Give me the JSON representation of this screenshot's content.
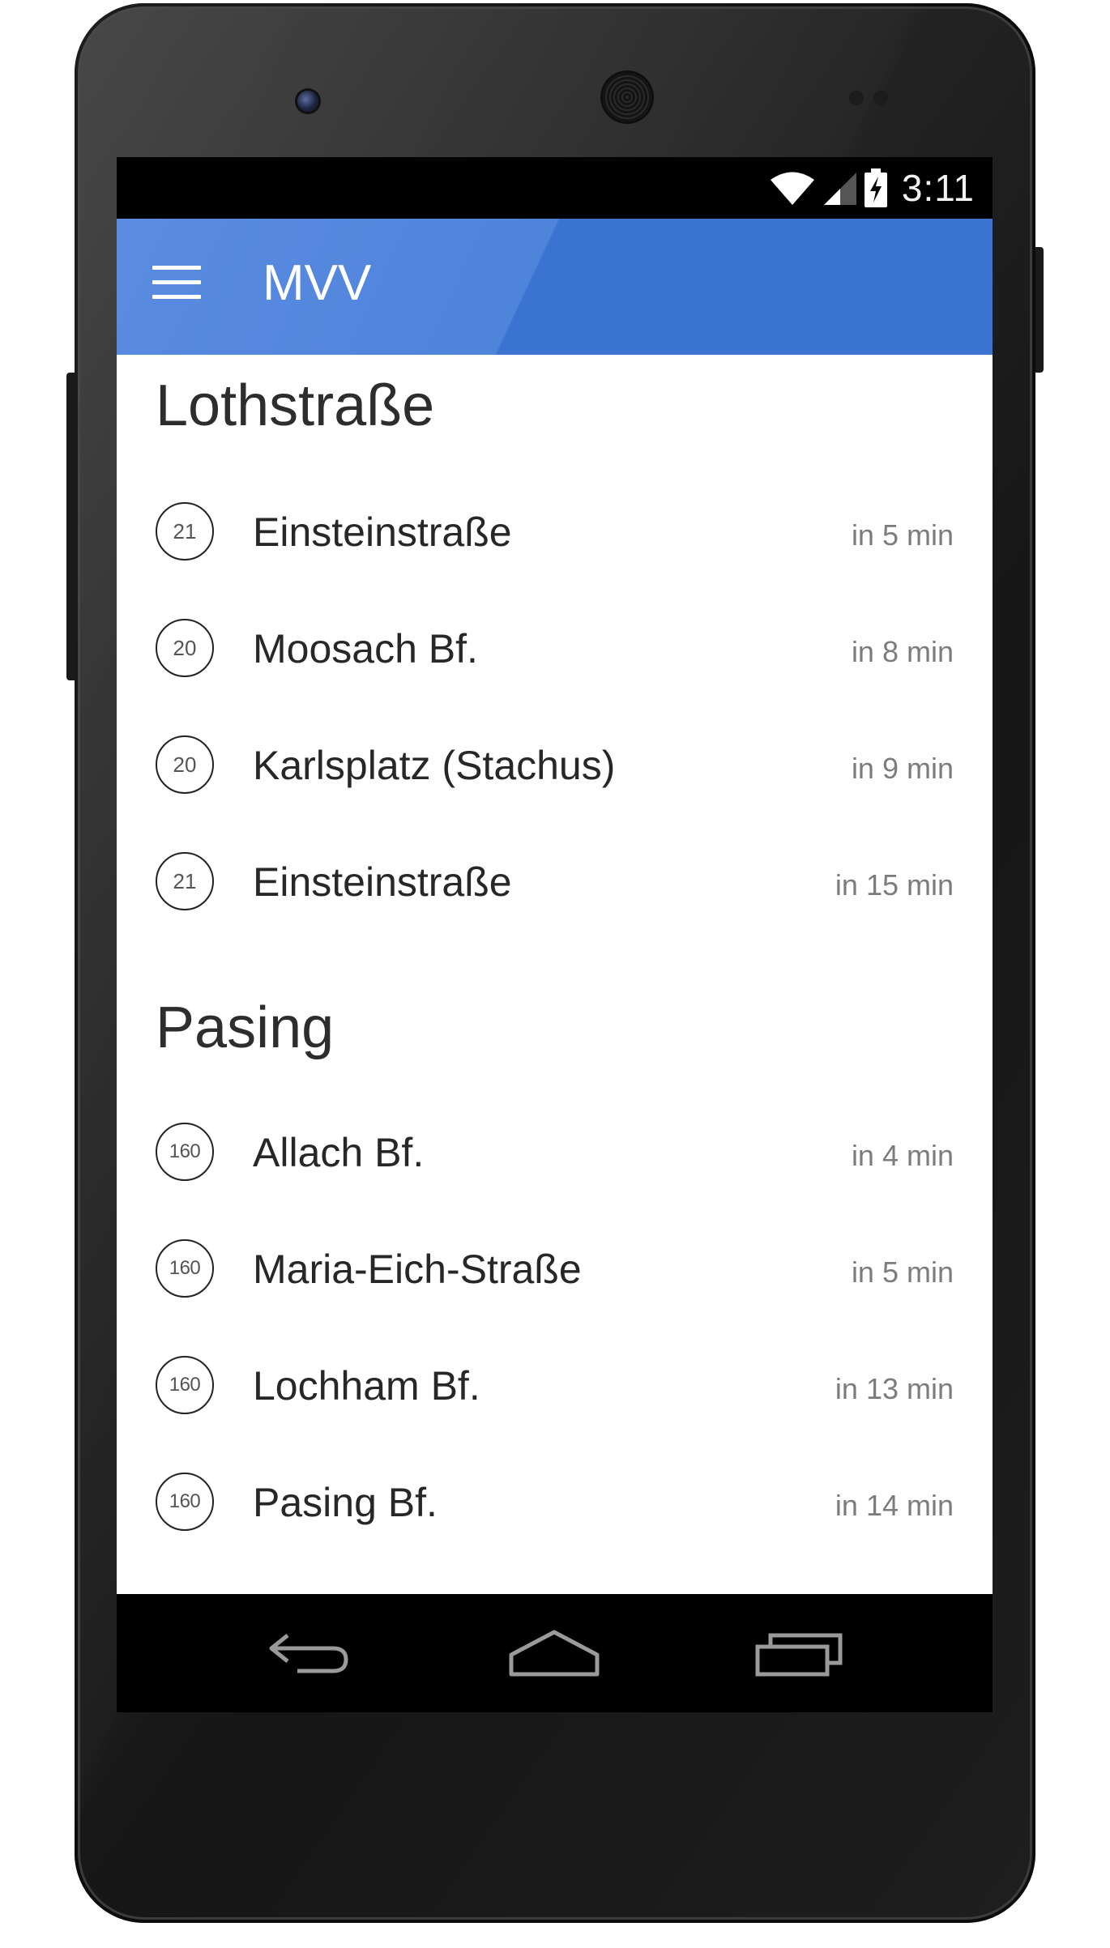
{
  "status_bar": {
    "time": "3:11",
    "icons": [
      "wifi-icon",
      "signal-icon",
      "battery-charging-icon"
    ]
  },
  "app_bar": {
    "title": "MVV",
    "menu_icon": "menu-icon"
  },
  "sections": [
    {
      "title": "Lothstraße",
      "departures": [
        {
          "line": "21",
          "destination": "Einsteinstraße",
          "eta": "in 5 min"
        },
        {
          "line": "20",
          "destination": "Moosach Bf.",
          "eta": "in 8 min"
        },
        {
          "line": "20",
          "destination": "Karlsplatz (Stachus)",
          "eta": "in 9 min"
        },
        {
          "line": "21",
          "destination": "Einsteinstraße",
          "eta": "in 15 min"
        }
      ]
    },
    {
      "title": "Pasing",
      "departures": [
        {
          "line": "160",
          "destination": "Allach Bf.",
          "eta": "in 4 min"
        },
        {
          "line": "160",
          "destination": "Maria-Eich-Straße",
          "eta": "in 5 min"
        },
        {
          "line": "160",
          "destination": "Lochham Bf.",
          "eta": "in 13 min"
        },
        {
          "line": "160",
          "destination": "Pasing Bf.",
          "eta": "in 14 min"
        }
      ]
    }
  ],
  "nav_bar": {
    "buttons": [
      "back-icon",
      "home-icon",
      "recents-icon"
    ]
  },
  "colors": {
    "app_bar": "#3b74d0",
    "app_bar_light": "#5a8ce0",
    "text_primary": "#272727",
    "text_secondary": "#7c7c7c"
  }
}
